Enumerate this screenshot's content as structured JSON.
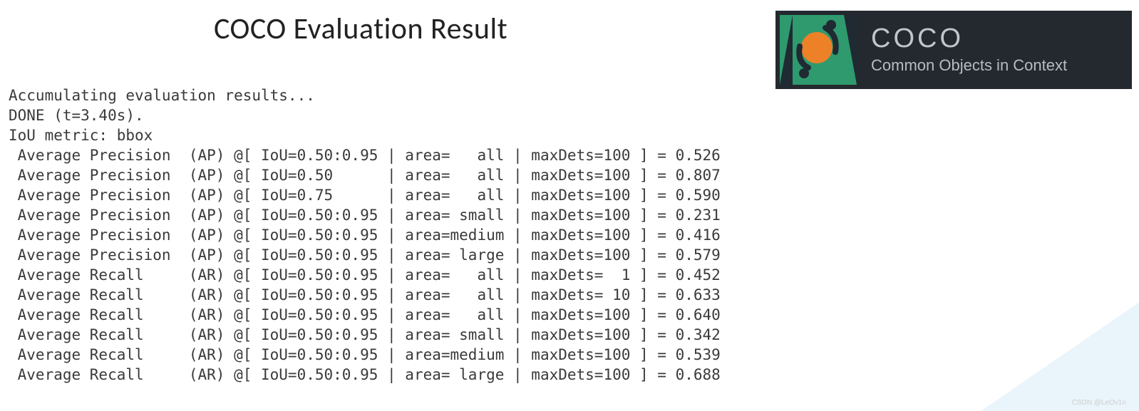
{
  "title": "COCO Evaluation Result",
  "logo": {
    "brand": "COCO",
    "tagline": "Common Objects in Context"
  },
  "terminal": {
    "preamble": [
      "Accumulating evaluation results...",
      "DONE (t=3.40s).",
      "IoU metric: bbox"
    ],
    "rows": [
      {
        "metric": "Average Precision",
        "abbr": "AP",
        "iou": "0.50:0.95",
        "area": "   all",
        "maxDets": "100",
        "value": "0.526"
      },
      {
        "metric": "Average Precision",
        "abbr": "AP",
        "iou": "0.50     ",
        "area": "   all",
        "maxDets": "100",
        "value": "0.807"
      },
      {
        "metric": "Average Precision",
        "abbr": "AP",
        "iou": "0.75     ",
        "area": "   all",
        "maxDets": "100",
        "value": "0.590"
      },
      {
        "metric": "Average Precision",
        "abbr": "AP",
        "iou": "0.50:0.95",
        "area": " small",
        "maxDets": "100",
        "value": "0.231"
      },
      {
        "metric": "Average Precision",
        "abbr": "AP",
        "iou": "0.50:0.95",
        "area": "medium",
        "maxDets": "100",
        "value": "0.416"
      },
      {
        "metric": "Average Precision",
        "abbr": "AP",
        "iou": "0.50:0.95",
        "area": " large",
        "maxDets": "100",
        "value": "0.579"
      },
      {
        "metric": "Average Recall",
        "abbr": "AR",
        "iou": "0.50:0.95",
        "area": "   all",
        "maxDets": "  1",
        "value": "0.452"
      },
      {
        "metric": "Average Recall",
        "abbr": "AR",
        "iou": "0.50:0.95",
        "area": "   all",
        "maxDets": " 10",
        "value": "0.633"
      },
      {
        "metric": "Average Recall",
        "abbr": "AR",
        "iou": "0.50:0.95",
        "area": "   all",
        "maxDets": "100",
        "value": "0.640"
      },
      {
        "metric": "Average Recall",
        "abbr": "AR",
        "iou": "0.50:0.95",
        "area": " small",
        "maxDets": "100",
        "value": "0.342"
      },
      {
        "metric": "Average Recall",
        "abbr": "AR",
        "iou": "0.50:0.95",
        "area": "medium",
        "maxDets": "100",
        "value": "0.539"
      },
      {
        "metric": "Average Recall",
        "abbr": "AR",
        "iou": "0.50:0.95",
        "area": " large",
        "maxDets": "100",
        "value": "0.688"
      }
    ]
  },
  "watermark": "CSDN @LeOv1n"
}
